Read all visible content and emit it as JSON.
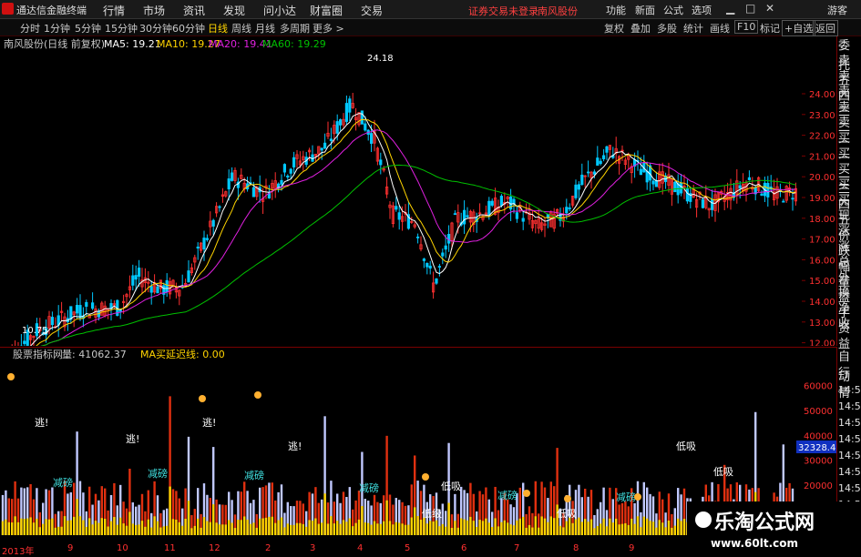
{
  "menubar": {
    "app_title": "通达信金融终端",
    "menus": [
      "行情",
      "市场",
      "资讯",
      "发现",
      "问小达",
      "财富圈",
      "交易"
    ],
    "warning": "证券交易未登录",
    "stock_name": "南风股份",
    "right": [
      "功能",
      "新面",
      "公式",
      "选项"
    ],
    "guest": "游客"
  },
  "toolbar": {
    "periods": [
      "分时",
      "1分钟",
      "5分钟",
      "15分钟",
      "30分钟",
      "60分钟",
      "日线",
      "周线",
      "月线",
      "多周期",
      "更多 >"
    ],
    "active_period": "日线",
    "buttons": [
      "复权",
      "叠加",
      "多股",
      "统计",
      "画线",
      "F10",
      "标记",
      "+自选",
      "返回"
    ]
  },
  "main_chart": {
    "title": "南风股份(日线 前复权)",
    "ma": [
      {
        "label": "MA5: 19.21",
        "color": "#ffffff"
      },
      {
        "label": "MA10: 19.27",
        "color": "#ffd400"
      },
      {
        "label": "MA20: 19.41",
        "color": "#e020e0"
      },
      {
        "label": "MA60: 19.29",
        "color": "#00c000"
      }
    ],
    "high_label": "24.18",
    "low_label": "10.75",
    "y_ticks": [
      "24.00",
      "23.00",
      "22.00",
      "21.00",
      "20.00",
      "19.00",
      "18.00",
      "17.00",
      "16.00",
      "15.00",
      "14.00",
      "13.00",
      "12.00"
    ]
  },
  "volume_chart": {
    "title": "股票指标网",
    "vol_label": "量: 41062.37",
    "ma_label": "MA买延迟线: 0.00",
    "y_ticks": [
      "60000",
      "50000",
      "40000",
      "30000",
      "20000"
    ],
    "current_value": "32328.45",
    "annotations": [
      "逃!",
      "减磅",
      "逃!",
      "减磅",
      "减磅",
      "逃!",
      "逃!",
      "低吸",
      "减磅",
      "减磅",
      "低吸",
      "低吸",
      "低吸",
      "减磅",
      "低级"
    ]
  },
  "right_panel": {
    "items": [
      "委托",
      "卖五",
      "卖四",
      "卖三",
      "卖二",
      "卖一",
      "买一",
      "买二",
      "买三",
      "买四",
      "买五",
      "现价",
      "涨跌",
      "涨幅",
      "总量",
      "外盘",
      "换手",
      "净资",
      "收益"
    ],
    "lower_items": [
      "自动",
      "行情",
      "14:50",
      "14:50",
      "14:50",
      "14:50",
      "14:50",
      "14:50",
      "14:50",
      "14:50",
      "14:50",
      "14:50"
    ]
  },
  "date_axis": {
    "labels": [
      "2013年",
      "9",
      "10",
      "11",
      "12",
      "2",
      "3",
      "4",
      "5",
      "6",
      "7",
      "8",
      "9"
    ]
  },
  "watermark": {
    "line1": "乐淘公式网",
    "line2": "www.60lt.com"
  },
  "colors": {
    "up": "#ff3030",
    "down": "#00c8ff",
    "ma5": "#ffffff",
    "ma10": "#ffd400",
    "ma20": "#e020e0",
    "ma60": "#00c000",
    "grid": "#7a0000"
  }
}
